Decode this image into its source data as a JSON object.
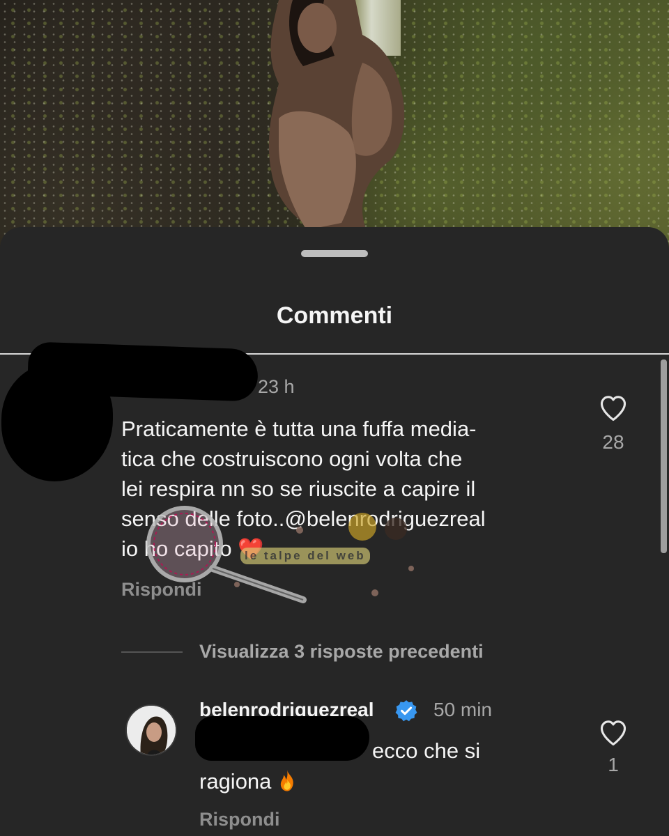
{
  "sheet": {
    "title": "Commenti"
  },
  "comment": {
    "time": "23 h",
    "text_lines": [
      "Praticamente è tutta una fuffa media-",
      "tica  che costruiscono ogni volta che",
      "lei respira nn so se riuscite a capire il",
      "senso delle foto..@belenrodriguezreal",
      "io ho capito"
    ],
    "emoji": "❤️",
    "reply_label": "Rispondi",
    "likes": "28"
  },
  "view_replies": "Visualizza 3 risposte precedenti",
  "reply": {
    "username": "belenrodriguezreal",
    "time": "50 min",
    "text_first": "ecco che si",
    "text_second": "ragiona",
    "reply_label": "Rispondi",
    "likes": "1"
  },
  "watermark": {
    "text": "le talpe del web"
  },
  "icons": {
    "like": "heart-outline-icon",
    "verified": "verified-badge-icon",
    "fire": "fire-emoji-icon",
    "handle": "drag-handle"
  },
  "colors": {
    "sheet_bg": "#262626",
    "text_primary": "#f5f5f5",
    "text_secondary": "#a8a8a8",
    "verified_blue": "#3897f0",
    "heart_red": "#e0245e"
  }
}
